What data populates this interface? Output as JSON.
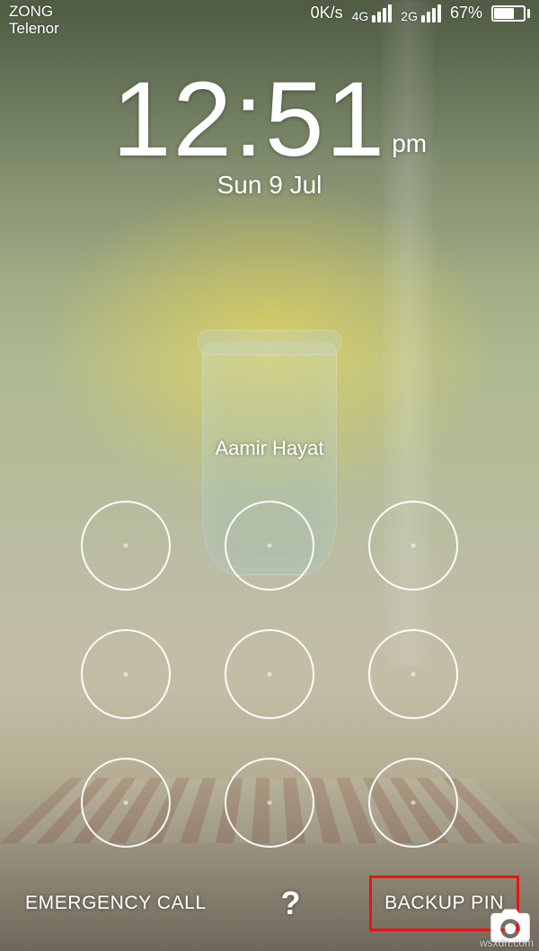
{
  "status": {
    "carriers": [
      "ZONG",
      "Telenor"
    ],
    "speed": "0K/s",
    "net1_label": "4G",
    "net2_label": "2G",
    "battery_pct": "67%"
  },
  "clock": {
    "time": "12:51",
    "ampm": "pm",
    "date": "Sun 9 Jul"
  },
  "owner": "Aamir Hayat",
  "actions": {
    "emergency": "EMERGENCY CALL",
    "help": "?",
    "backup": "BACKUP PIN"
  },
  "footer": "wsxdn.com",
  "icons": {
    "camera": "camera-icon"
  }
}
